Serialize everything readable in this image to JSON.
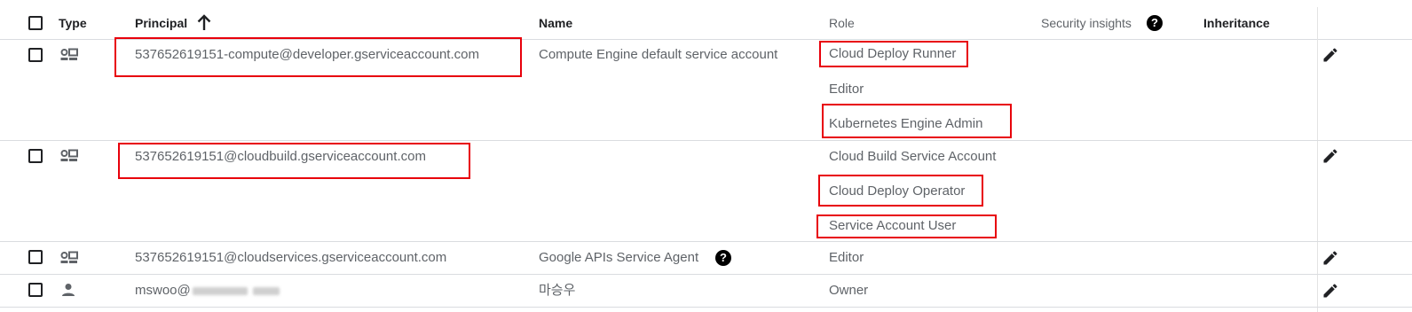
{
  "header": {
    "type": "Type",
    "principal": "Principal",
    "name": "Name",
    "role": "Role",
    "security_insights": "Security insights",
    "inheritance": "Inheritance"
  },
  "rows": [
    {
      "principal_type": "service-account",
      "principal": "537652619151-compute@developer.gserviceaccount.com",
      "name": "Compute Engine default service account",
      "roles": [
        "Cloud Deploy Runner",
        "Editor",
        "Kubernetes Engine Admin"
      ]
    },
    {
      "principal_type": "service-account",
      "principal": "537652619151@cloudbuild.gserviceaccount.com",
      "name": "",
      "roles": [
        "Cloud Build Service Account",
        "Cloud Deploy Operator",
        "Service Account User"
      ]
    },
    {
      "principal_type": "service-account",
      "principal": "537652619151@cloudservices.gserviceaccount.com",
      "name": "Google APIs Service Agent",
      "roles": [
        "Editor"
      ]
    },
    {
      "principal_type": "user",
      "principal": "mswoo@",
      "name": "마승우",
      "roles": [
        "Owner"
      ]
    }
  ],
  "icons": {
    "sort": "arrow-up-icon",
    "help": "help-circle-icon",
    "service_account": "service-account-icon",
    "user": "person-icon",
    "edit": "pencil-icon"
  },
  "colors": {
    "highlight": "#e8000b",
    "text": "#5f6368",
    "header_text": "#202124",
    "divider": "#dadce0"
  }
}
